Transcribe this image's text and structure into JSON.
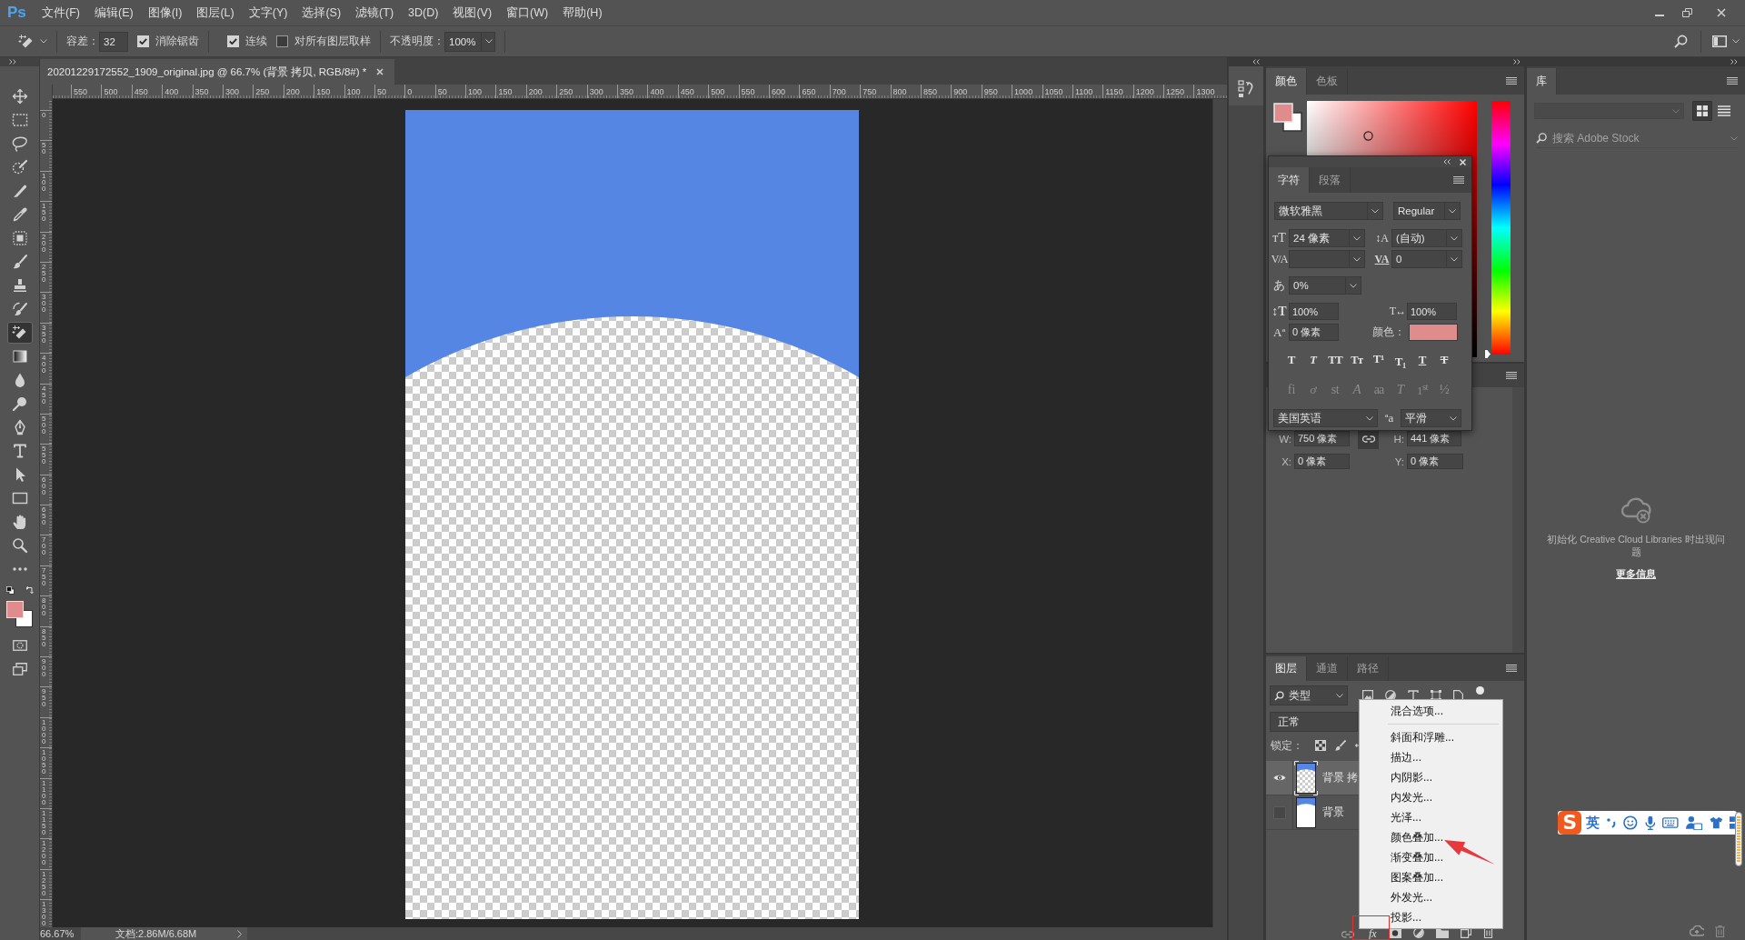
{
  "app": {
    "logo": "Ps"
  },
  "menu_bar": [
    "文件(F)",
    "编辑(E)",
    "图像(I)",
    "图层(L)",
    "文字(Y)",
    "选择(S)",
    "滤镜(T)",
    "3D(D)",
    "视图(V)",
    "窗口(W)",
    "帮助(H)"
  ],
  "options_bar": {
    "tolerance_label": "容差：",
    "tolerance": "32",
    "checkboxes": [
      {
        "label": "消除锯齿",
        "checked": true
      },
      {
        "label": "连续",
        "checked": true
      },
      {
        "label": "对所有图层取样",
        "checked": false
      }
    ],
    "opacity_label": "不透明度：",
    "opacity": "100%"
  },
  "document_tab": {
    "title": "20201229172552_1909_original.jpg @ 66.7% (背景 拷贝, RGB/8#) *"
  },
  "rulers": {
    "horizontal": [
      "550",
      "500",
      "450",
      "400",
      "350",
      "300",
      "250",
      "200",
      "150",
      "100",
      "50",
      "0",
      "50",
      "100",
      "150",
      "200",
      "250",
      "300",
      "350",
      "400",
      "450",
      "500",
      "550",
      "600",
      "650",
      "700",
      "750",
      "800",
      "850",
      "900",
      "950",
      "1000",
      "1050",
      "1100",
      "1150",
      "1200",
      "1250",
      "1300"
    ],
    "vertical": [
      "0",
      "50",
      "100",
      "150",
      "200",
      "250",
      "300",
      "350",
      "400",
      "450",
      "500",
      "550",
      "600",
      "650",
      "700",
      "750",
      "800",
      "850",
      "900",
      "950",
      "1000",
      "1050",
      "1100",
      "1150",
      "1200",
      "1250",
      "1300"
    ]
  },
  "toolbar": {
    "tools": [
      {
        "kind": "move",
        "selected": false
      },
      {
        "kind": "marquee",
        "selected": false
      },
      {
        "kind": "lasso",
        "selected": false
      },
      {
        "kind": "quick_select",
        "selected": false
      },
      {
        "kind": "slice",
        "selected": false
      },
      {
        "kind": "eyedropper",
        "selected": false
      },
      {
        "kind": "patch",
        "selected": false
      },
      {
        "kind": "brush",
        "selected": false
      },
      {
        "kind": "stamp",
        "selected": false
      },
      {
        "kind": "history_brush",
        "selected": false
      },
      {
        "kind": "magic_eraser",
        "selected": true
      },
      {
        "kind": "gradient",
        "selected": false
      },
      {
        "kind": "blur",
        "selected": false
      },
      {
        "kind": "dodge",
        "selected": false
      },
      {
        "kind": "pen",
        "selected": false
      },
      {
        "kind": "type",
        "selected": false
      },
      {
        "kind": "path_select",
        "selected": false
      },
      {
        "kind": "rectangle",
        "selected": false
      },
      {
        "kind": "hand",
        "selected": false
      },
      {
        "kind": "zoom",
        "selected": false
      },
      {
        "kind": "more",
        "selected": false
      }
    ],
    "swatches": [
      {
        "kind": "foreground",
        "color": "#e08c8c"
      },
      {
        "kind": "background",
        "color": "#ffffff"
      }
    ]
  },
  "status_bar": {
    "zoom": "66.67%",
    "document": "文档:2.86M/6.68M"
  },
  "color_panel": {
    "tabs": [
      {
        "label": "颜色",
        "selected": true
      },
      {
        "label": "色板",
        "selected": false
      }
    ],
    "swatches": [
      {
        "kind": "foreground",
        "color": "#e08c8c"
      },
      {
        "kind": "background",
        "color": "#ffffff"
      }
    ],
    "hue_slider": {
      "level": 0
    }
  },
  "character_panel": {
    "tabs": [
      {
        "label": "字符",
        "selected": true
      },
      {
        "label": "段落",
        "selected": false
      }
    ],
    "font_family": "微软雅黑",
    "font_style": "Regular",
    "metrics": [
      {
        "kind": "size",
        "symbol": "ᴛT",
        "value": "24 像素"
      },
      {
        "kind": "leading",
        "symbol": "↕A",
        "value": "(自动)"
      },
      {
        "kind": "kerning",
        "symbol": "V/A"
      },
      {
        "kind": "tracking",
        "symbol": "VA",
        "value": "0"
      }
    ],
    "tsume": {
      "symbol": "あ",
      "value": "0%"
    },
    "scales": [
      {
        "kind": "vertical",
        "symbol": "↕T",
        "value": "100%"
      },
      {
        "kind": "horizontal",
        "symbol": "T↔",
        "value": "100%"
      }
    ],
    "baseline": {
      "symbol": "Aª",
      "value": "0 像素"
    },
    "color_label": "颜色：",
    "color_swatch": {
      "color": "#e08c8c"
    },
    "style_buttons": [
      {
        "kind": "bold",
        "text": "T",
        "disabled": false
      },
      {
        "kind": "italic",
        "text": "T",
        "disabled": false
      },
      {
        "kind": "all_caps",
        "text": "TT",
        "disabled": false
      },
      {
        "kind": "small_caps",
        "text": "Tᴛ",
        "disabled": false
      },
      {
        "kind": "superscript",
        "text": "T¹",
        "disabled": false
      },
      {
        "kind": "subscript",
        "text": "T₁",
        "disabled": false
      },
      {
        "kind": "underline",
        "text": "T",
        "disabled": false
      },
      {
        "kind": "strikethrough",
        "text": "T",
        "disabled": false
      }
    ],
    "opentype_buttons": [
      {
        "kind": "ligatures",
        "text": "fi",
        "disabled": true
      },
      {
        "kind": "contextual",
        "text": "ơ",
        "disabled": true
      },
      {
        "kind": "discretionary",
        "text": "st",
        "disabled": true
      },
      {
        "kind": "swash",
        "text": "A",
        "disabled": true
      },
      {
        "kind": "stylistic",
        "text": "aa",
        "disabled": true
      },
      {
        "kind": "titling",
        "text": "T",
        "disabled": true
      },
      {
        "kind": "ordinals",
        "text": "1$^{st}$",
        "disabled": true
      },
      {
        "kind": "fractions",
        "text": "½",
        "disabled": true
      }
    ],
    "language": "美国英语",
    "antialias_symbol": "ªa",
    "antialias": "平滑"
  },
  "properties_panel": {
    "fields": [
      {
        "label": "W:",
        "value": "750 像素"
      },
      {
        "label": "H:",
        "value": "441 像素"
      },
      {
        "label": "X:",
        "value": "0 像素"
      },
      {
        "label": "Y:",
        "value": "0 像素"
      }
    ],
    "linked": true
  },
  "layers_panel": {
    "tabs": [
      {
        "label": "图层",
        "selected": true
      },
      {
        "label": "通道",
        "selected": false
      },
      {
        "label": "路径",
        "selected": false
      }
    ],
    "filter": "类型",
    "blend_mode": "正常",
    "lock_label": "锁定：",
    "layers": [
      {
        "name": "背景 拷",
        "kind": "transparent",
        "visible": true,
        "selected": true
      },
      {
        "name": "背景",
        "kind": "opaque",
        "visible": false,
        "selected": false
      }
    ],
    "effects_label": "fx"
  },
  "context_menu": {
    "items": [
      {
        "kind": "option",
        "label": "混合选项..."
      },
      {
        "kind": "separator"
      },
      {
        "kind": "option",
        "label": "斜面和浮雕..."
      },
      {
        "kind": "option",
        "label": "描边..."
      },
      {
        "kind": "option",
        "label": "内阴影..."
      },
      {
        "kind": "option",
        "label": "内发光..."
      },
      {
        "kind": "option",
        "label": "光泽..."
      },
      {
        "kind": "option",
        "label": "颜色叠加..."
      },
      {
        "kind": "option",
        "label": "渐变叠加..."
      },
      {
        "kind": "option",
        "label": "图案叠加..."
      },
      {
        "kind": "option",
        "label": "外发光..."
      },
      {
        "kind": "option",
        "label": "投影..."
      }
    ]
  },
  "library_panel": {
    "tabs": [
      {
        "label": "库",
        "selected": true
      }
    ],
    "view_modes": [
      {
        "kind": "grid",
        "selected": true
      },
      {
        "kind": "list",
        "selected": false
      }
    ],
    "search_placeholder": "搜索 Adobe Stock",
    "message": "初始化 Creative Cloud Libraries 时出现问题",
    "link": "更多信息"
  },
  "ime_toolbar": {
    "logo": "S",
    "mode": "英"
  }
}
